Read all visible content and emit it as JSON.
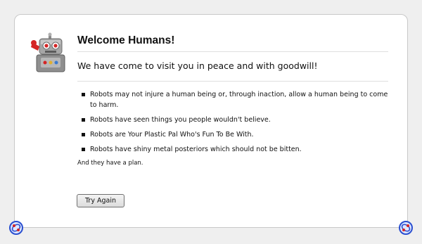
{
  "header": {
    "title": "Welcome Humans!",
    "subtitle": "We have come to visit you in peace and with goodwill!"
  },
  "rules": [
    "Robots may not injure a human being or, through inaction, allow a human being to come to harm.",
    "Robots have seen things you people wouldn't believe.",
    "Robots are Your Plastic Pal Who's Fun To Be With.",
    "Robots have shiny metal posteriors which should not be bitten."
  ],
  "note": "And they have a plan.",
  "actions": {
    "try_again_label": "Try Again"
  },
  "icons": {
    "main": "robot-icon",
    "corners": "bubble-robot-icon"
  },
  "colors": {
    "page_background": "#efefef",
    "card_background": "#ffffff",
    "robot_red": "#d42424",
    "robot_grey": "#9a9a9a",
    "corner_blue": "#2a4fd0"
  }
}
